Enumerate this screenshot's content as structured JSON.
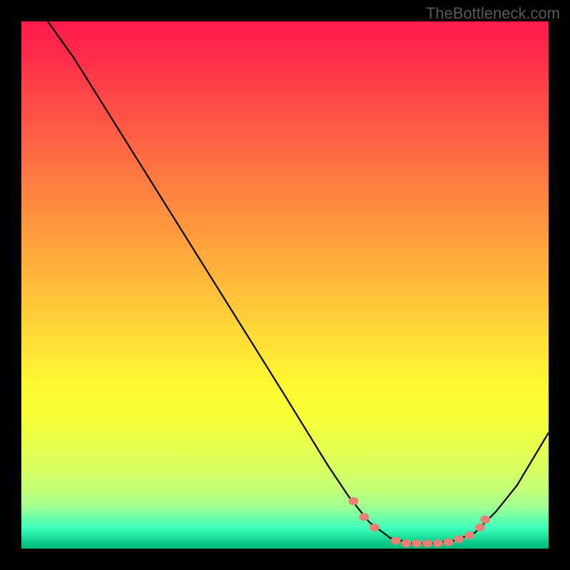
{
  "watermark": "TheBottleneck.com",
  "chart_data": {
    "type": "line",
    "title": "",
    "xlabel": "",
    "ylabel": "",
    "xlim": [
      0,
      100
    ],
    "ylim": [
      0,
      100
    ],
    "series": [
      {
        "name": "curve",
        "points": [
          {
            "x": 5,
            "y": 100
          },
          {
            "x": 10,
            "y": 93
          },
          {
            "x": 20,
            "y": 77
          },
          {
            "x": 30,
            "y": 61
          },
          {
            "x": 40,
            "y": 45
          },
          {
            "x": 50,
            "y": 29
          },
          {
            "x": 58,
            "y": 16
          },
          {
            "x": 62,
            "y": 10
          },
          {
            "x": 66,
            "y": 5
          },
          {
            "x": 70,
            "y": 2
          },
          {
            "x": 74,
            "y": 1
          },
          {
            "x": 78,
            "y": 1
          },
          {
            "x": 82,
            "y": 1.5
          },
          {
            "x": 86,
            "y": 3
          },
          {
            "x": 90,
            "y": 7
          },
          {
            "x": 94,
            "y": 12
          },
          {
            "x": 100,
            "y": 22
          }
        ]
      }
    ],
    "markers": [
      {
        "x": 63,
        "y": 9
      },
      {
        "x": 65,
        "y": 6
      },
      {
        "x": 67,
        "y": 4
      },
      {
        "x": 71,
        "y": 1.5
      },
      {
        "x": 73,
        "y": 1
      },
      {
        "x": 75,
        "y": 1
      },
      {
        "x": 77,
        "y": 1
      },
      {
        "x": 79,
        "y": 1
      },
      {
        "x": 81,
        "y": 1.2
      },
      {
        "x": 83,
        "y": 1.8
      },
      {
        "x": 85,
        "y": 2.5
      },
      {
        "x": 87,
        "y": 4
      },
      {
        "x": 88,
        "y": 5.5
      }
    ]
  }
}
